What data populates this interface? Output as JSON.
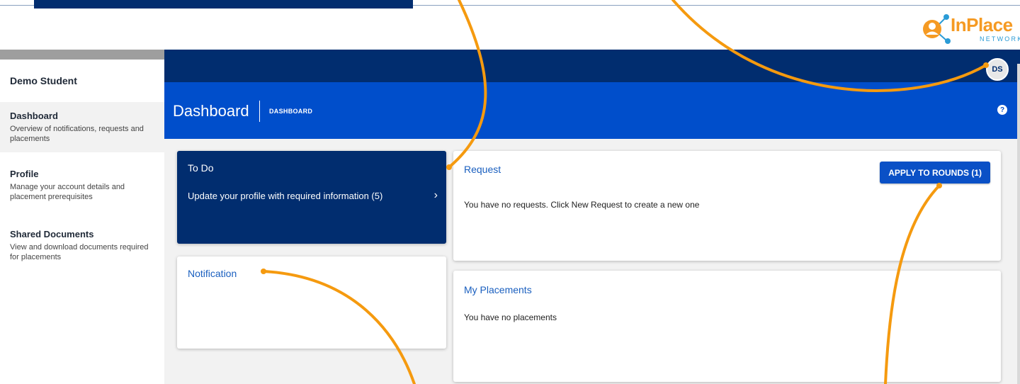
{
  "logo": {
    "text": "InPlace",
    "subtitle": "NETWORK"
  },
  "sidebar": {
    "user_name": "Demo Student",
    "items": [
      {
        "title": "Dashboard",
        "description": "Overview of notifications, requests and placements",
        "active": true
      },
      {
        "title": "Profile",
        "description": "Manage your account details and placement prerequisites",
        "active": false
      },
      {
        "title": "Shared Documents",
        "description": "View and download documents required for placements",
        "active": false
      }
    ]
  },
  "topbar": {
    "avatar_initials": "DS"
  },
  "header": {
    "title": "Dashboard",
    "breadcrumb": "DASHBOARD",
    "help": "?"
  },
  "todo": {
    "title": "To Do",
    "item": "Update your profile with required information (5)",
    "chevron": "›"
  },
  "notification": {
    "title": "Notification"
  },
  "request": {
    "title": "Request",
    "apply_button": "APPLY TO ROUNDS (1)",
    "empty_text": "You have no requests. Click New Request to create a new one"
  },
  "placements": {
    "title": "My Placements",
    "empty_text": "You have no placements"
  },
  "colors": {
    "navy": "#012d6f",
    "primary_blue": "#004ecb",
    "link_blue": "#1a5fbf",
    "annotation_orange": "#f59a0f"
  }
}
